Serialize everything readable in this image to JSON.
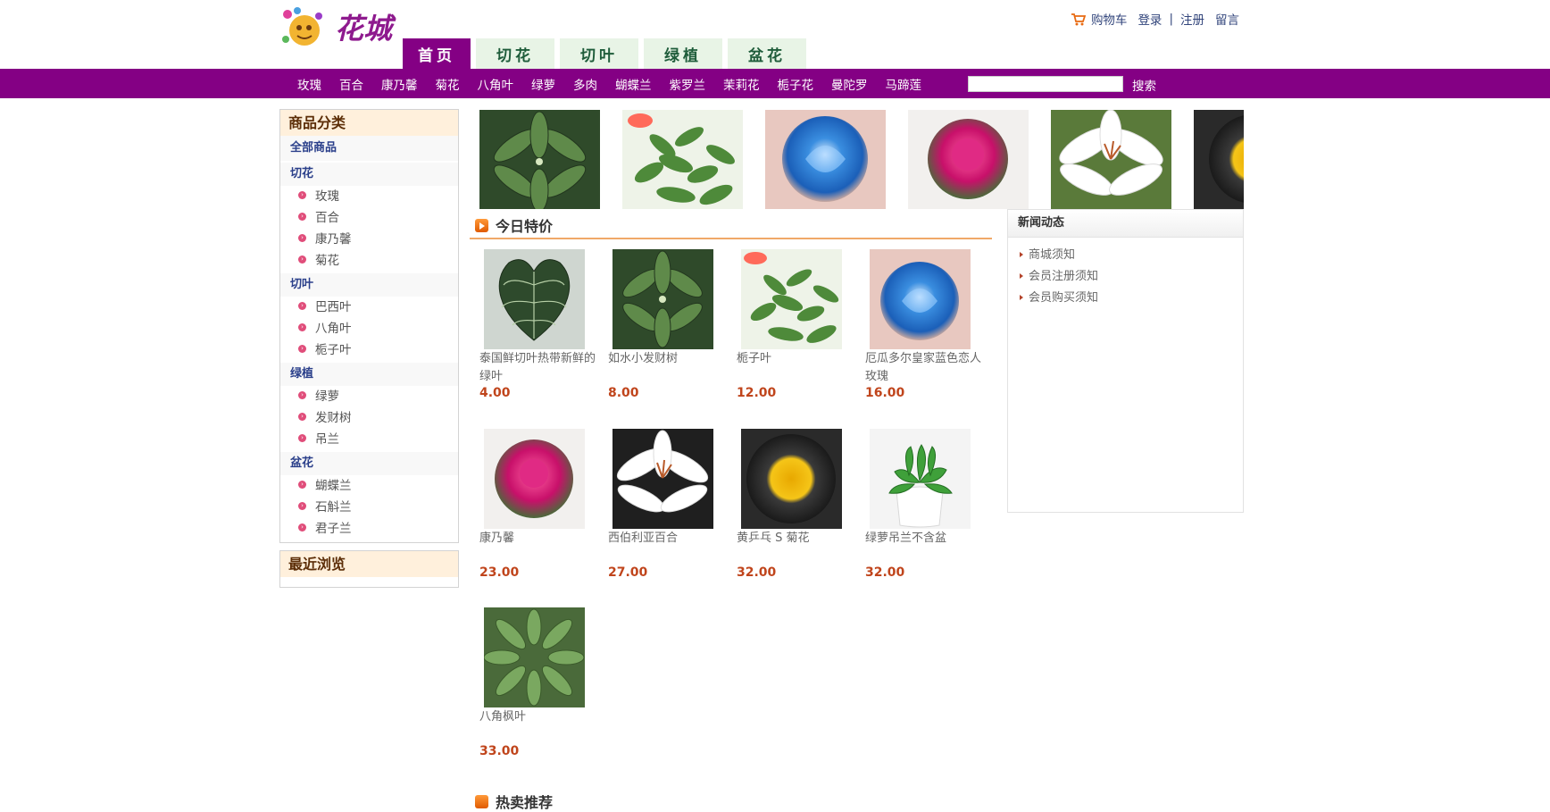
{
  "header": {
    "logo_text": "花城",
    "top_links": {
      "cart": "购物车",
      "login": "登录",
      "separator": "|",
      "register": "注册",
      "message": "留言"
    },
    "main_tabs": [
      "首页",
      "切花",
      "切叶",
      "绿植",
      "盆花"
    ]
  },
  "nav": {
    "items": [
      "玫瑰",
      "百合",
      "康乃馨",
      "菊花",
      "八角叶",
      "绿萝",
      "多肉",
      "蝴蝶兰",
      "紫罗兰",
      "茉莉花",
      "栀子花",
      "曼陀罗",
      "马蹄莲"
    ],
    "search_value": "",
    "search_label": "搜索"
  },
  "sidebar": {
    "category_title": "商品分类",
    "all_label": "全部商品",
    "groups": [
      {
        "name": "切花",
        "items": [
          "玫瑰",
          "百合",
          "康乃馨",
          "菊花"
        ]
      },
      {
        "name": "切叶",
        "items": [
          "巴西叶",
          "八角叶",
          "栀子叶"
        ]
      },
      {
        "name": "绿植",
        "items": [
          "绿萝",
          "发财树",
          "吊兰"
        ]
      },
      {
        "name": "盆花",
        "items": [
          "蝴蝶兰",
          "石斛兰",
          "君子兰"
        ]
      }
    ],
    "recent_title": "最近浏览"
  },
  "banner": [
    "money-plant",
    "gardenia-leaf",
    "blue-rose",
    "pink-carnation",
    "white-lily",
    "yellow-chrysanthemum"
  ],
  "today_special": {
    "title": "今日特价",
    "products": [
      {
        "name": "泰国鲜切叶热带新鲜的绿叶",
        "price": "4.00",
        "img": "anthurium-leaf"
      },
      {
        "name": "如水小发财树",
        "price": "8.00",
        "img": "money-plant"
      },
      {
        "name": "栀子叶",
        "price": "12.00",
        "img": "gardenia-leaf"
      },
      {
        "name": "厄瓜多尔皇家蓝色恋人玫瑰",
        "price": "16.00",
        "img": "blue-rose"
      },
      {
        "name": "康乃馨",
        "price": "23.00",
        "img": "pink-carnation"
      },
      {
        "name": "西伯利亚百合",
        "price": "27.00",
        "img": "white-lily"
      },
      {
        "name": "黄乒乓 S 菊花",
        "price": "32.00",
        "img": "yellow-chrysanthemum"
      },
      {
        "name": "绿萝吊兰不含盆",
        "price": "32.00",
        "img": "pothos-pot"
      },
      {
        "name": "八角枫叶",
        "price": "33.00",
        "img": "fatsia-leaf"
      }
    ]
  },
  "news": {
    "title": "新闻动态",
    "items": [
      "商城须知",
      "会员注册须知",
      "会员购买须知"
    ]
  },
  "hot_title": "热卖推荐",
  "colors": {
    "brand_purple": "#840084",
    "price_red": "#c0451c",
    "tab_green": "#e8f4e6"
  }
}
